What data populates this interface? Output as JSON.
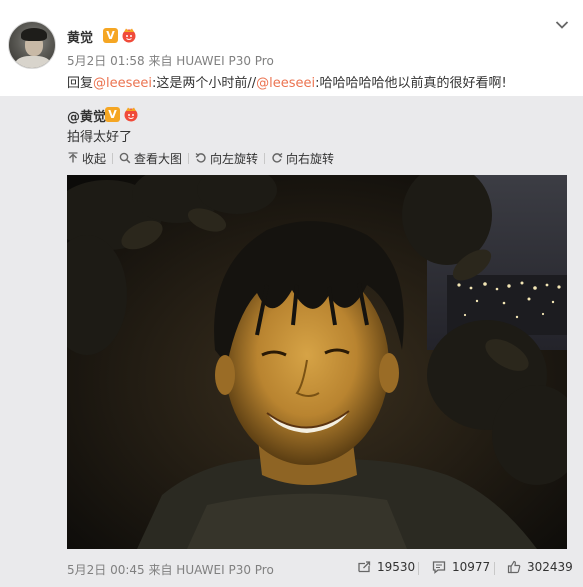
{
  "post": {
    "author": "黄觉",
    "meta": "5月2日 01:58 来自 HUAWEI P30 Pro",
    "reply_prefix": "回复",
    "mention1": "@leeseei",
    "reply_text": ":这是两个小时前//",
    "mention2": "@leeseei",
    "quoted_text": ":哈哈哈哈哈他以前真的很好看啊!"
  },
  "repost": {
    "author": "@黄觉",
    "text": "拍得太好了",
    "tools": {
      "collapse": "收起",
      "view_large": "查看大图",
      "rotate_left": "向左旋转",
      "rotate_right": "向右旋转"
    },
    "meta": "5月2日 00:45 来自 HUAWEI P30 Pro",
    "stats": {
      "reposts": "19530",
      "comments": "10977",
      "likes": "302439"
    }
  },
  "badges": {
    "verified": "V"
  },
  "colors": {
    "mention": "#eb7350",
    "verified": "#f5a623",
    "meta_gray": "#808080"
  },
  "icons": [
    "chevron-down-icon",
    "verified-badge-icon",
    "crown-badge-icon",
    "collapse-icon",
    "search-icon",
    "rotate-left-icon",
    "rotate-right-icon",
    "repost-icon",
    "comment-icon",
    "like-icon"
  ]
}
